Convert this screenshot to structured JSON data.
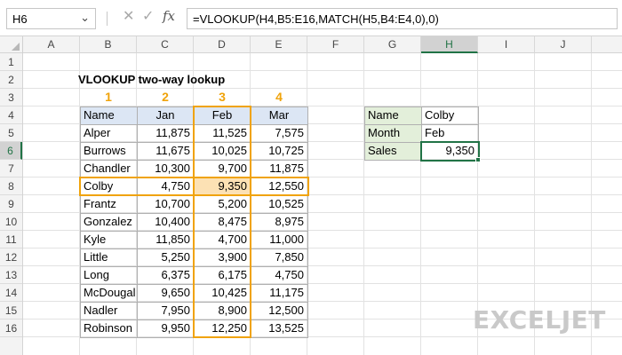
{
  "formula_bar": {
    "name_box": "H6",
    "fx": "fx",
    "formula": "=VLOOKUP(H4,B5:E16,MATCH(H5,B4:E4,0),0)"
  },
  "columns": [
    "A",
    "B",
    "C",
    "D",
    "E",
    "F",
    "G",
    "H",
    "I",
    "J"
  ],
  "rows": [
    "1",
    "2",
    "3",
    "4",
    "5",
    "6",
    "7",
    "8",
    "9",
    "10",
    "11",
    "12",
    "13",
    "14",
    "15",
    "16"
  ],
  "active_cell": {
    "column": "H",
    "row": "6"
  },
  "sheet": {
    "title": "VLOOKUP two-way lookup",
    "markers": [
      "1",
      "2",
      "3",
      "4"
    ],
    "table": {
      "headers": [
        "Name",
        "Jan",
        "Feb",
        "Mar"
      ],
      "rows": [
        [
          "Alper",
          "11,875",
          "11,525",
          "7,575"
        ],
        [
          "Burrows",
          "11,675",
          "10,025",
          "10,725"
        ],
        [
          "Chandler",
          "10,300",
          "9,700",
          "11,875"
        ],
        [
          "Colby",
          "4,750",
          "9,350",
          "12,550"
        ],
        [
          "Frantz",
          "10,700",
          "5,200",
          "10,525"
        ],
        [
          "Gonzalez",
          "10,400",
          "8,475",
          "8,975"
        ],
        [
          "Kyle",
          "11,850",
          "4,700",
          "11,000"
        ],
        [
          "Little",
          "5,250",
          "3,900",
          "7,850"
        ],
        [
          "Long",
          "6,375",
          "6,175",
          "4,750"
        ],
        [
          "McDougal",
          "9,650",
          "10,425",
          "11,175"
        ],
        [
          "Nadler",
          "7,950",
          "8,900",
          "12,500"
        ],
        [
          "Robinson",
          "9,950",
          "12,250",
          "13,525"
        ]
      ]
    },
    "lookup": {
      "name_label": "Name",
      "name_value": "Colby",
      "month_label": "Month",
      "month_value": "Feb",
      "sales_label": "Sales",
      "sales_value": "9,350"
    }
  },
  "logo": "EXCELJET",
  "colors": {
    "accent": "#f0a30a",
    "highlight": "#fce1b4",
    "header_fill": "#dce6f4",
    "label_fill": "#e3efda",
    "selection": "#217346"
  }
}
